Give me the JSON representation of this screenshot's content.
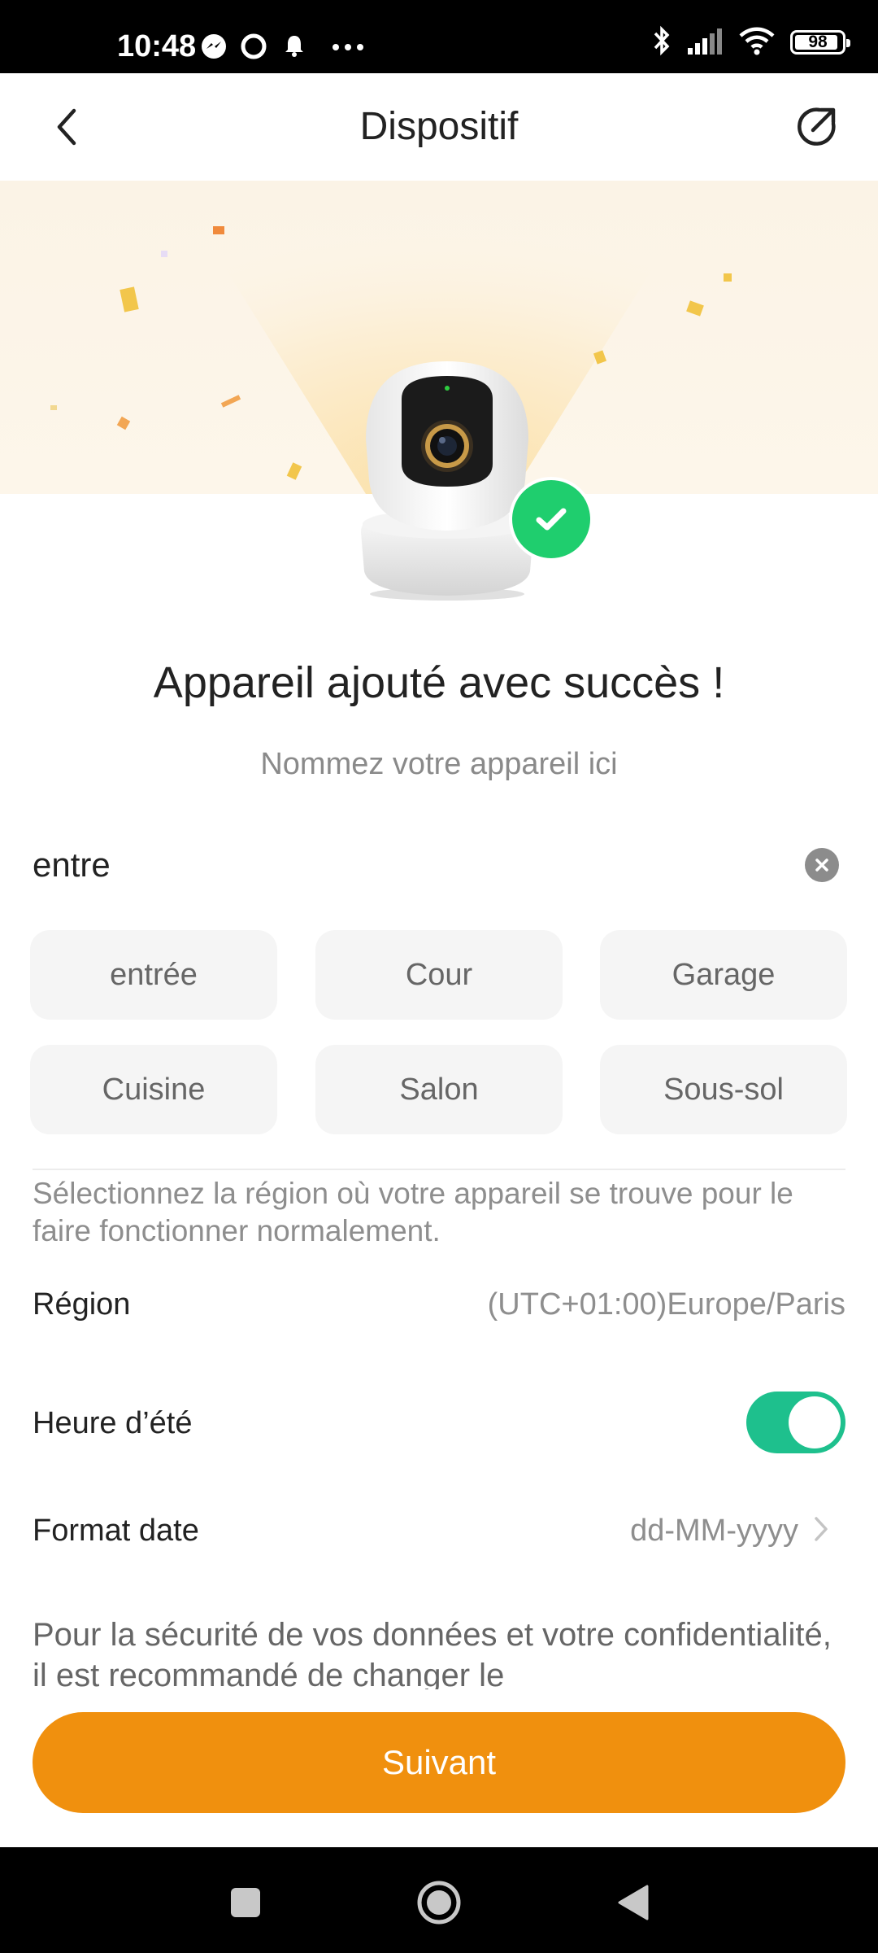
{
  "status_bar": {
    "time": "10:48",
    "battery": "98",
    "icons": [
      "messenger-icon",
      "circle-app-icon",
      "notification-bell-icon",
      "more-dots-icon",
      "bluetooth-icon",
      "signal-icon",
      "wifi-icon",
      "battery-icon"
    ]
  },
  "header": {
    "title": "Dispositif",
    "back_icon": "chevron-left-icon",
    "share_icon": "external-link-icon"
  },
  "hero": {
    "title": "Appareil ajouté avec succès !",
    "subtitle": "Nommez votre appareil ici"
  },
  "name_field": {
    "value": "entre",
    "placeholder": "Nommez votre appareil ici"
  },
  "suggestions": [
    "entrée",
    "Cour",
    "Garage",
    "Cuisine",
    "Salon",
    "Sous-sol"
  ],
  "region_hint": "Sélectionnez la région où votre appareil se trouve pour le faire fonctionner normalement.",
  "settings": {
    "region_label": "Région",
    "region_value": "(UTC+01:00)Europe/Paris",
    "dst_label": "Heure d’été",
    "dst_enabled": true,
    "date_format_label": "Format date",
    "date_format_value": "dd-MM-yyyy"
  },
  "security_text": "Pour la sécurité de vos données et votre confidentialité, il est recommandé de changer le",
  "next_button": "Suivant",
  "colors": {
    "accent": "#f0900e",
    "toggle_on": "#1ec08d",
    "success": "#1fce6e"
  }
}
